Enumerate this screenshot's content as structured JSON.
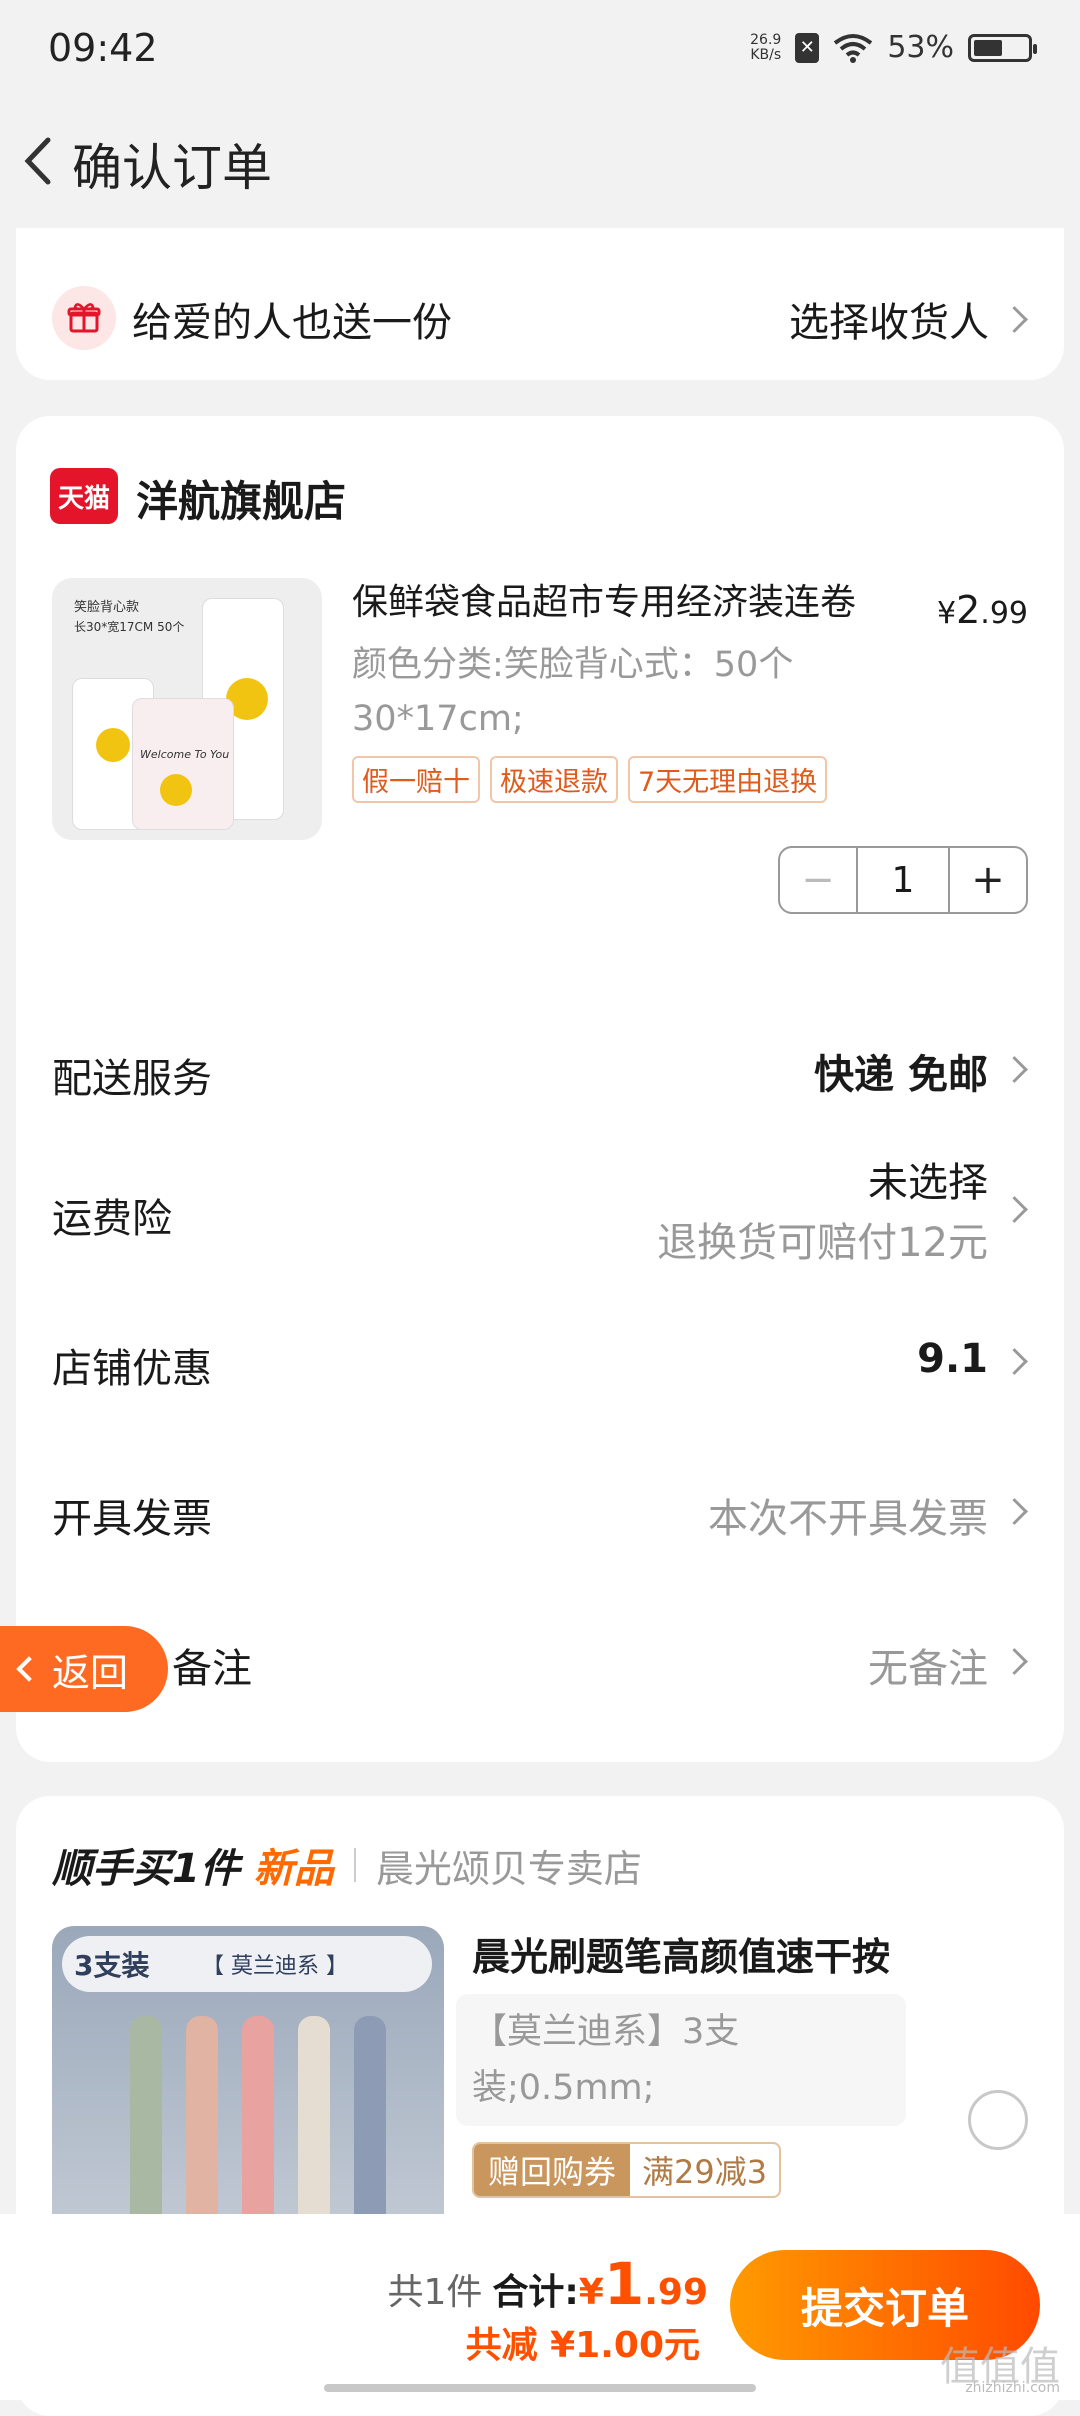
{
  "status_bar": {
    "time": "09:42",
    "net_speed_value": "26.9",
    "net_speed_unit": "KB/s",
    "battery_percent": "53%",
    "battery_level": 0.53
  },
  "nav": {
    "title": "确认订单",
    "back_icon": "chevron-left-icon"
  },
  "gift": {
    "text": "给爱的人也送一份",
    "action": "选择收货人",
    "icon": "gift-icon"
  },
  "shop": {
    "badge": "天猫",
    "name": "洋航旗舰店"
  },
  "product": {
    "image_caption_1": "笑脸背心款",
    "image_caption_2": "长30*宽17CM  50个",
    "image_bag_text": "Welcome To You",
    "title": "保鲜袋食品超市专用经济装连卷",
    "price_symbol": "¥",
    "price_int": "2",
    "price_dec": ".99",
    "sku": "颜色分类:笑脸背心式：50个 30*17cm;",
    "tags": [
      "假一赔十",
      "极速退款",
      "7天无理由退换"
    ],
    "quantity": "1",
    "minus": "−",
    "plus": "+"
  },
  "rows": {
    "delivery": {
      "label": "配送服务",
      "value": "快递 免邮"
    },
    "insurance": {
      "label": "运费险",
      "value": "未选择",
      "sub": "退换货可赔付12元"
    },
    "shop_discount": {
      "label": "店铺优惠",
      "value": "9.1"
    },
    "invoice": {
      "label": "开具发票",
      "value": "本次不开具发票"
    },
    "remark": {
      "label": "备注",
      "value": "无备注"
    }
  },
  "float_back": {
    "label": "返回"
  },
  "recommend": {
    "heading": "顺手买1件",
    "new_label": "新品",
    "shop": "晨光颂贝专卖店",
    "img_count": "3支装",
    "img_series": "【 莫兰迪系 】",
    "title": "晨光刷题笔高颜值速干按",
    "sku": "【莫兰迪系】3支装;0.5mm;",
    "coupon_a": "赠回购券",
    "coupon_b": "满29减3",
    "pen_colors": [
      "#a9b8a2",
      "#e0b3a3",
      "#e8a3a0",
      "#e6ddd2",
      "#8d9bb5"
    ]
  },
  "bottom": {
    "count": "共1件",
    "total_label": "合计:",
    "total_symbol": "¥",
    "total_int": "1",
    "total_dec": ".99",
    "discount": "共减 ¥1.00元",
    "submit": "提交订单",
    "watermark": "值值值",
    "watermark_sub": "zhizhizhi.com"
  }
}
